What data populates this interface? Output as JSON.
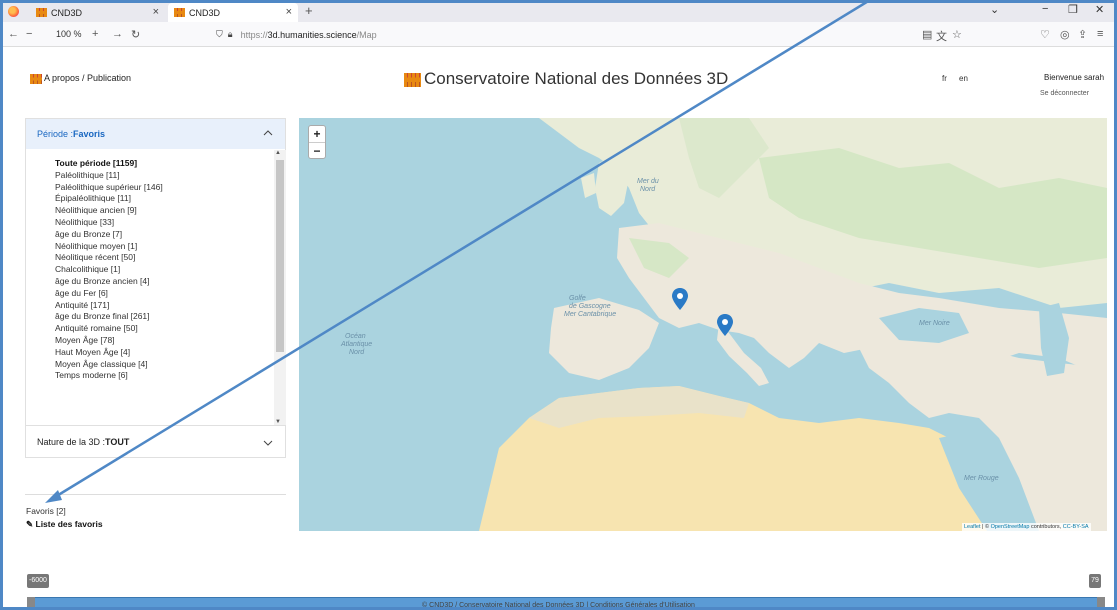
{
  "browser": {
    "tabs": [
      {
        "label": "CND3D"
      },
      {
        "label": "CND3D"
      }
    ],
    "zoom": "100 %",
    "url_prefix": "https://",
    "url_domain": "3d.humanities.science",
    "url_path": "/Map"
  },
  "header": {
    "left_link": "A propos / Publication",
    "title": "Conservatoire National des Données 3D",
    "lang_fr": "fr",
    "lang_en": "en",
    "welcome": "Bienvenue sarah",
    "logout": "Se déconnecter"
  },
  "sidebar": {
    "period_label": "Période : ",
    "period_value": "Favoris",
    "periods": [
      "Toute période [1159]",
      "Paléolithique [11]",
      "Paléolithique supérieur [146]",
      "Épipaléolithique [11]",
      "Néolithique ancien [9]",
      "Néolithique [33]",
      "âge du Bronze [7]",
      "Néolithique moyen [1]",
      "Néolitique récent [50]",
      "Chalcolithique [1]",
      "âge du Bronze ancien [4]",
      "âge du Fer [6]",
      "Antiquité [171]",
      "âge du Bronze final [261]",
      "Antiquité romaine [50]",
      "Moyen Âge [78]",
      "Haut Moyen Âge [4]",
      "Moyen Âge classique [4]",
      "Temps moderne [6]"
    ],
    "nature_label": "Nature de la 3D : ",
    "nature_value": "TOUT",
    "favoris": "Favoris [2]",
    "favoris_list": "Liste des favoris"
  },
  "map": {
    "zoom_in": "+",
    "zoom_out": "−",
    "labels": {
      "ocean": "Océan Atlantique Nord",
      "mer_du_nord": "Mer du Nord",
      "mer_noire": "Mer Noire",
      "mer_rouge": "Mer Rouge",
      "golfe": "Golfe de Gascogne",
      "mer_cantabrique": "Mer Cantabrique"
    },
    "attribution_link": "Leaflet",
    "attribution_text": " | © ",
    "attribution_osm": "OpenStreetMap",
    "attribution_rest": " contributors, ",
    "attribution_license": "CC-BY-SA",
    "markers": 2,
    "colors": {
      "water": "#aad3df",
      "land": "#f2efe9",
      "green": "#cfe6c0",
      "desert": "#f7e4b0",
      "marker": "#2a7ac6"
    }
  },
  "slider": {
    "min_label": "-6000",
    "max_label": "79"
  },
  "footer": "© CND3D / Conservatoire National des Données 3D | Conditions Générales d'Utilisation"
}
